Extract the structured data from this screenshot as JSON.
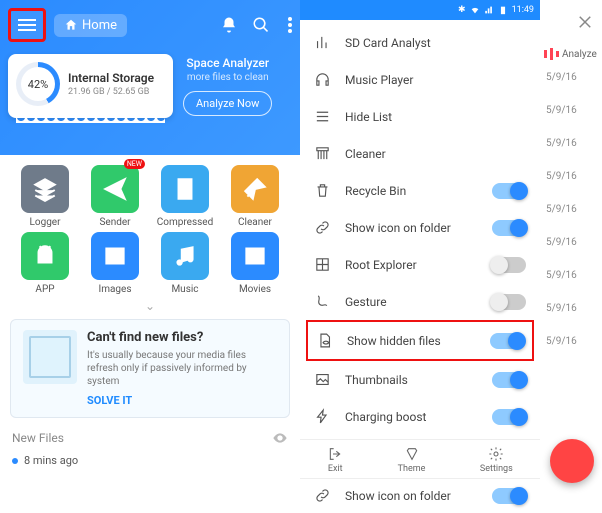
{
  "left": {
    "home_label": "Home",
    "storage": {
      "percent": "42%",
      "title": "Internal Storage",
      "detail": "21.96 GB / 52.65 GB"
    },
    "analyzer": {
      "title": "Space Analyzer",
      "subtitle": "more files to clean",
      "button": "Analyze Now"
    },
    "tiles": [
      {
        "label": "Logger",
        "color": "#6f7b8a",
        "icon": "layers",
        "badge": ""
      },
      {
        "label": "Sender",
        "color": "#30c96b",
        "icon": "send",
        "badge": "NEW"
      },
      {
        "label": "Compressed",
        "color": "#3aa9f0",
        "icon": "zip",
        "badge": ""
      },
      {
        "label": "Cleaner",
        "color": "#f0a534",
        "icon": "broom",
        "badge": ""
      },
      {
        "label": "APP",
        "color": "#30c96b",
        "icon": "android",
        "badge": ""
      },
      {
        "label": "Images",
        "color": "#2b8bff",
        "icon": "image",
        "badge": ""
      },
      {
        "label": "Music",
        "color": "#3aa9f0",
        "icon": "music",
        "badge": ""
      },
      {
        "label": "Movies",
        "color": "#2b8bff",
        "icon": "play",
        "badge": ""
      }
    ],
    "promo": {
      "title": "Can't find new files?",
      "body": "It's usually because your media files refresh only if passively informed by system",
      "cta": "SOLVE IT"
    },
    "newfiles_label": "New Files",
    "newfiles_item": "8 mins ago"
  },
  "mid": {
    "status_time": "11:49",
    "items": [
      {
        "label": "SD Card Analyst",
        "icon": "bars",
        "toggle": null
      },
      {
        "label": "Music Player",
        "icon": "headphone",
        "toggle": null
      },
      {
        "label": "Hide List",
        "icon": "list",
        "toggle": null
      },
      {
        "label": "Cleaner",
        "icon": "broom",
        "toggle": null
      },
      {
        "label": "Recycle Bin",
        "icon": "trash",
        "toggle": true
      },
      {
        "label": "Show icon on folder",
        "icon": "link",
        "toggle": true
      },
      {
        "label": "Root Explorer",
        "icon": "root",
        "toggle": false
      },
      {
        "label": "Gesture",
        "icon": "gesture",
        "toggle": false
      },
      {
        "label": "Show hidden files",
        "icon": "file-eye",
        "toggle": true,
        "highlight": true
      },
      {
        "label": "Thumbnails",
        "icon": "picture",
        "toggle": true
      },
      {
        "label": "Charging boost",
        "icon": "bolt",
        "toggle": true
      }
    ],
    "bottom": [
      {
        "label": "Exit",
        "icon": "exit"
      },
      {
        "label": "Theme",
        "icon": "theme"
      },
      {
        "label": "Settings",
        "icon": "gear"
      }
    ],
    "extra": {
      "label": "Show icon on folder",
      "toggle": true
    }
  },
  "right": {
    "analyze_label": "Analyze",
    "dates": [
      "5/9/16",
      "5/9/16",
      "5/9/16",
      "5/9/16",
      "5/9/16",
      "5/9/16",
      "5/9/16",
      "5/9/16",
      "5/9/16"
    ]
  }
}
